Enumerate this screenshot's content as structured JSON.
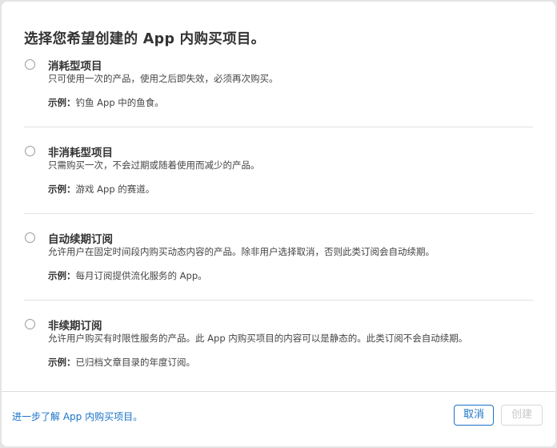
{
  "dialog": {
    "title": "选择您希望创建的 App 内购买项目。"
  },
  "options": [
    {
      "title": "消耗型项目",
      "description": "只可使用一次的产品，使用之后即失效，必须再次购买。",
      "example_label": "示例：",
      "example_text": "钓鱼 App 中的鱼食。",
      "selected": false
    },
    {
      "title": "非消耗型项目",
      "description": "只需购买一次，不会过期或随着使用而减少的产品。",
      "example_label": "示例：",
      "example_text": "游戏 App 的赛道。",
      "selected": false
    },
    {
      "title": "自动续期订阅",
      "description": "允许用户在固定时间段内购买动态内容的产品。除非用户选择取消，否则此类订阅会自动续期。",
      "example_label": "示例：",
      "example_text": "每月订阅提供流化服务的 App。",
      "selected": false
    },
    {
      "title": "非续期订阅",
      "description": "允许用户购买有时限性服务的产品。此 App 内购买项目的内容可以是静态的。此类订阅不会自动续期。",
      "example_label": "示例：",
      "example_text": "已归档文章目录的年度订阅。",
      "selected": false
    }
  ],
  "footer": {
    "learn_more_link": "进一步了解 App 内购买项目。",
    "cancel_label": "取消",
    "create_label": "创建",
    "create_enabled": false
  },
  "colors": {
    "accent": "#1a73c8",
    "disabled_text": "#c8c8c8",
    "divider": "#e2e2e2"
  }
}
